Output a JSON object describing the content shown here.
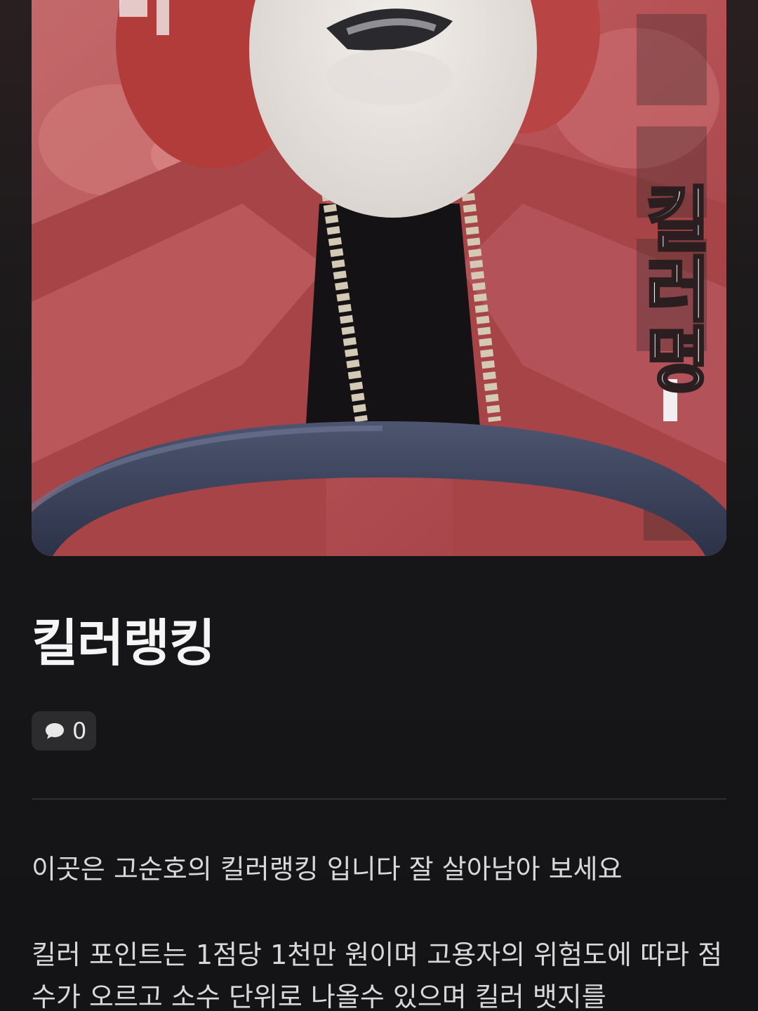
{
  "post": {
    "cover_image": {
      "overlay_text": "킬러명"
    },
    "title": "킬러랭킹",
    "comments": {
      "icon": "comment-bubble-icon",
      "count": "0"
    },
    "paragraphs": [
      "이곳은 고순호의 킬러랭킹 입니다 잘 살아남아 보세요",
      "킬러 포인트는 1점당 1천만 원이며 고용자의 위험도에 따라 점수가 오르고 소수 단위로 나올수 있으며 킬러 뱃지를"
    ]
  },
  "colors": {
    "background": "#141416",
    "chip_background": "#2c2c2f",
    "jacket": "#b8575a"
  }
}
